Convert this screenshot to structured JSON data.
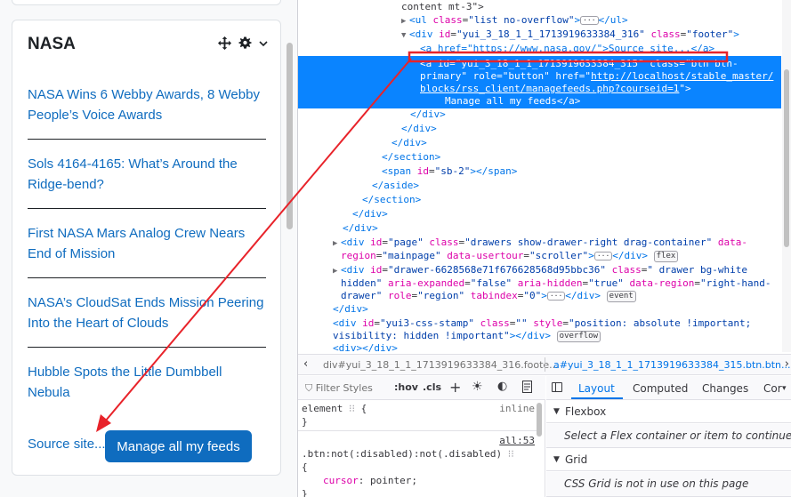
{
  "block": {
    "title": "NASA",
    "controls": {
      "move": "move-icon",
      "settings": "gear-icon",
      "menu": "chevron-down-icon"
    },
    "news": [
      {
        "line1": "NASA Wins 6 Webby Awards, 8 Webby",
        "line2": "People’s Voice Awards"
      },
      {
        "line1": "Sols 4164-4165: What’s Around the",
        "line2": "Ridge-bend?"
      },
      {
        "line1": "First NASA Mars Analog Crew Nears",
        "line2": "End of Mission"
      },
      {
        "line1": "NASA’s CloudSat Ends Mission Peering",
        "line2": "Into the Heart of Clouds"
      },
      {
        "line1": "Hubble Spots the Little Dumbbell",
        "line2": "Nebula"
      }
    ],
    "source_link": "Source site...",
    "manage_button": "Manage all my feeds"
  },
  "devtools": {
    "markup": {
      "l0": "content mt-3\">",
      "l1_tag": "<ul",
      "l1_attr": "class",
      "l1_val": "\"list no-overflow\"",
      "l1_end": "</ul>",
      "l2_tag": "<div",
      "l2_attr1": "id",
      "l2_val1": "\"yui_3_18_1_1_1713919633384_316\"",
      "l2_attr2": "class",
      "l2_val2": "\"footer\"",
      "l2_end": ">",
      "l3": "<a href=\"https://www.nasa.gov/\">Source site...</a>",
      "sel1": "<a id=\"yui_3_18_1_1_1713919633384_315\" class=\"btn btn-",
      "sel2_a": "primary\" role=\"button\" href=\"",
      "sel2_link": "http://localhost/stable_master/",
      "sel3_link": "blocks/rss_client/managefeeds.php?courseid=1",
      "sel3_end": "\">",
      "sel4": "Manage all my feeds</a>",
      "c1": "</div>",
      "c2": "</div>",
      "c3": "</div>",
      "c4": "</section>",
      "c5_tag": "<span",
      "c5_attr": "id",
      "c5_val": "\"sb-2\"",
      "c5_end": "></span>",
      "c6": "</aside>",
      "c7": "</section>",
      "c8": "</div>",
      "c9": "</div>",
      "p1a_tag": "<div",
      "p1a_attr1": "id",
      "p1a_val1": "\"page\"",
      "p1a_attr2": "class",
      "p1a_val2": "\"drawers show-drawer-right drag-container\"",
      "p1a_attr3": "data-",
      "p1b_attr": "region",
      "p1b_val": "\"mainpage\"",
      "p1b_attr2": "data-usertour",
      "p1b_val2": "\"scroller\"",
      "p1b_end": "</div>",
      "p1b_badge": "flex",
      "p2a_tag": "<div",
      "p2a_attr1": "id",
      "p2a_val1": "\"drawer-6628568e71f676628568d95bbc36\"",
      "p2a_attr2": "class",
      "p2a_val2": "\" drawer bg-white",
      "p2b_val": "hidden\"",
      "p2b_attr1": "aria-expanded",
      "p2b_val1": "\"false\"",
      "p2b_attr2": "aria-hidden",
      "p2b_val2": "\"true\"",
      "p2b_attr3": "data-region",
      "p2b_val3": "\"right-hand-",
      "p2c_val": "drawer\"",
      "p2c_attr1": "role",
      "p2c_val1": "\"region\"",
      "p2c_attr2": "tabindex",
      "p2c_val2": "\"0\"",
      "p2c_end": "</div>",
      "p2c_badge": "event",
      "p3": "</div>",
      "p4_tag": "<div",
      "p4_attr1": "id",
      "p4_val1": "\"yui3-css-stamp\"",
      "p4_attr2": "class",
      "p4_val2": "\"\"",
      "p4_attr3": "style",
      "p4_val3": "\"position: absolute !important;",
      "p5_val": "visibility: hidden !important\"",
      "p5_end": "></div>",
      "p5_badge": "overflow",
      "p6_tag": "<div>",
      "p6_end": "</div>"
    },
    "breadcrumbs": {
      "item1": "div#yui_3_18_1_1_1713919633384_316.foote...",
      "item2": "a#yui_3_18_1_1_1713919633384_315.btn.btn..."
    },
    "rules": {
      "filter_placeholder": "Filter Styles",
      "hov": ":hov",
      "cls": ".cls",
      "add": "+",
      "r1_sel": "element",
      "r1_open": " {",
      "r1_src": "inline",
      "r1_close": "}",
      "r2_src": "all:53",
      "r2_sel": ".btn:not(:disabled):not(.disabled)",
      "r2_open": "{",
      "r2_prop": "cursor",
      "r2_val": "pointer;",
      "r2_close": "}"
    },
    "layout": {
      "tabs": [
        "Layout",
        "Computed",
        "Changes",
        "Cor"
      ],
      "flexbox_title": "Flexbox",
      "flexbox_note": "Select a Flex container or item to continue.",
      "grid_title": "Grid",
      "grid_note": "CSS Grid is not in use on this page"
    }
  },
  "colors": {
    "link": "#0f6cbf",
    "button": "#0f6cbf",
    "selection": "#0a84ff",
    "annotation": "#e8232a"
  }
}
